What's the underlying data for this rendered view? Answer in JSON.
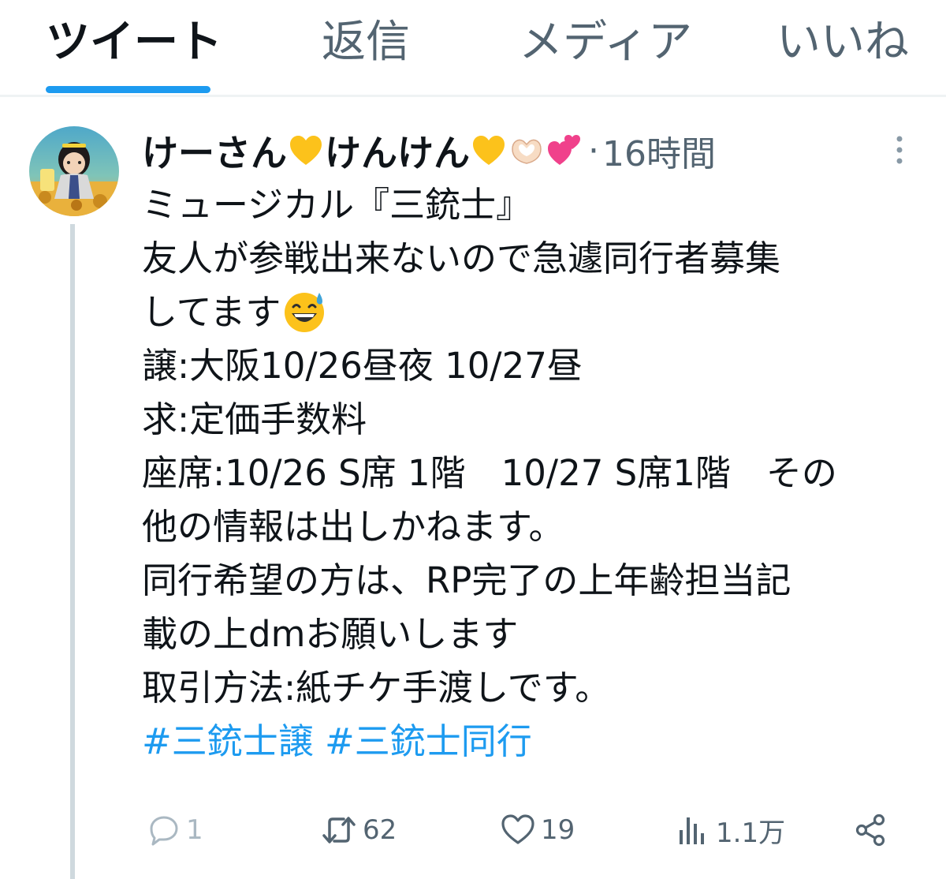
{
  "tabs": [
    {
      "label": "ツイート",
      "active": true
    },
    {
      "label": "返信",
      "active": false
    },
    {
      "label": "メディア",
      "active": false
    },
    {
      "label": "いいね",
      "active": false
    }
  ],
  "tweet": {
    "display_name_part1": "けーさん",
    "display_name_part2": "けんけん",
    "separator": "·",
    "timestamp": "16時間",
    "avatar_text": "けーさん",
    "lines": [
      "ミュージカル『三銃士』",
      "友人が参戦出来ないので急遽同行者募集",
      "してます",
      "譲:大阪10/26昼夜 10/27昼",
      "求:定価手数料",
      "座席:10/26 S席 1階　10/27 S席1階　その",
      "他の情報は出しかねます。",
      "同行希望の方は、RP完了の上年齢担当記",
      "載の上dmお願いします",
      "取引方法:紙チケ手渡しです。"
    ],
    "hashtags": [
      "#三銃士譲",
      "#三銃士同行"
    ],
    "actions": {
      "replies": "1",
      "retweets": "62",
      "likes": "19",
      "views": "1.1万"
    }
  },
  "icons": {
    "more": "more-vertical-icon",
    "reply": "reply-icon",
    "retweet": "retweet-icon",
    "like": "heart-icon",
    "views": "views-chart-icon",
    "share": "share-icon"
  },
  "colors": {
    "accent": "#1d9bf0",
    "text_primary": "#0f1419",
    "text_secondary": "#536471",
    "divider": "#eff3f4"
  }
}
